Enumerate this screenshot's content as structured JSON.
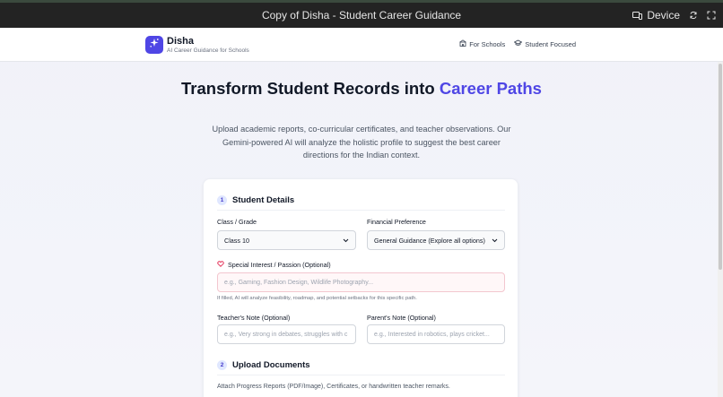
{
  "window": {
    "title": "Copy of Disha - Student Career Guidance",
    "device_label": "Device"
  },
  "header": {
    "brand_name": "Disha",
    "brand_tagline": "AI Career Guidance for Schools",
    "nav": [
      {
        "label": "For Schools",
        "icon": "school-icon"
      },
      {
        "label": "Student Focused",
        "icon": "graduation-cap-icon"
      }
    ]
  },
  "hero": {
    "title_main": "Transform Student Records into ",
    "title_accent": "Career Paths",
    "description": "Upload academic reports, co-curricular certificates, and teacher observations. Our Gemini-powered AI will analyze the holistic profile to suggest the best career directions for the Indian context."
  },
  "form": {
    "section1": {
      "number": "1",
      "title": "Student Details"
    },
    "class_grade": {
      "label": "Class / Grade",
      "value": "Class 10"
    },
    "financial": {
      "label": "Financial Preference",
      "value": "General Guidance (Explore all options)"
    },
    "interest": {
      "label": "Special Interest / Passion (Optional)",
      "placeholder": "e.g., Gaming, Fashion Design, Wildlife Photography...",
      "hint": "If filled, AI will analyze feasibility, roadmap, and potential setbacks for this specific path."
    },
    "teacher_note": {
      "label": "Teacher's Note (Optional)",
      "placeholder": "e.g., Very strong in debates, struggles with c"
    },
    "parent_note": {
      "label": "Parent's Note (Optional)",
      "placeholder": "e.g., Interested in robotics, plays cricket..."
    },
    "section2": {
      "number": "2",
      "title": "Upload Documents"
    },
    "upload_description": "Attach Progress Reports (PDF/Image), Certificates, or handwritten teacher remarks."
  },
  "colors": {
    "accent": "#4f46e5",
    "heart": "#e11d48"
  }
}
